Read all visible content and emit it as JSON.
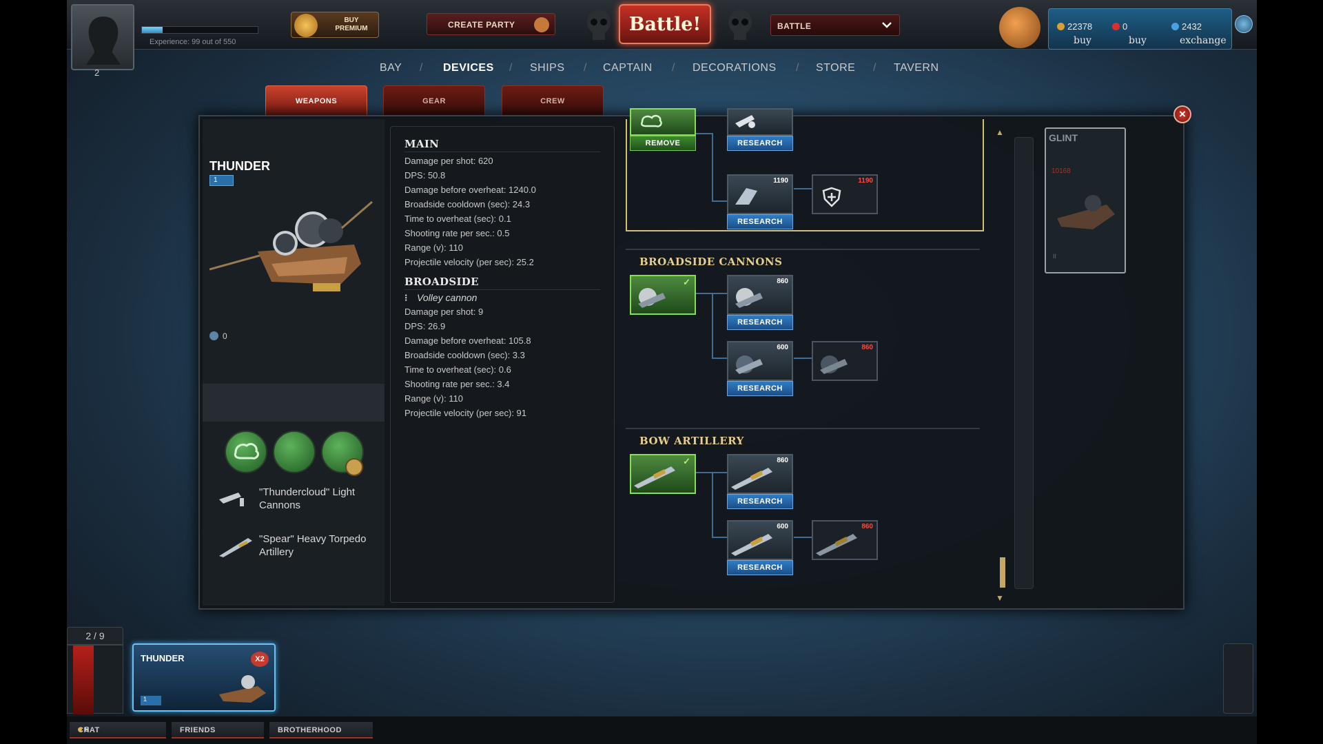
{
  "player": {
    "level": "2",
    "experience_text": "Experience: 99 out of 550",
    "experience_fraction": 0.18
  },
  "topbar": {
    "buy_premium": "BUY PREMIUM",
    "create_party": "CREATE PARTY",
    "battle": "Battle!",
    "battle_mode": "BATTLE"
  },
  "currency": {
    "gold": "22378",
    "gold_action": "buy",
    "red": "0",
    "red_action": "buy",
    "blue": "2432",
    "blue_action": "exchange",
    "gold_color": "#d8a030",
    "red_color": "#d83030",
    "blue_color": "#4aa0e0"
  },
  "nav": {
    "items": [
      "BAY",
      "DEVICES",
      "SHIPS",
      "CAPTAIN",
      "DECORATIONS",
      "STORE",
      "TAVERN"
    ],
    "active": "DEVICES"
  },
  "subtabs": {
    "items": [
      "WEAPONS",
      "GEAR",
      "CREW"
    ],
    "active": "WEAPONS"
  },
  "ship": {
    "name": "THUNDER",
    "level": "1",
    "count": "0",
    "weapons": [
      {
        "label": "\"Thundercloud\" Light Cannons",
        "icon": "light-cannon-icon"
      },
      {
        "label": "\"Spear\" Heavy Torpedo Artillery",
        "icon": "torpedo-icon"
      }
    ]
  },
  "stats": {
    "main_title": "MAIN",
    "main": [
      "Damage per shot:  620",
      "DPS:  50.8",
      "Damage before overheat:  1240.0",
      "Broadside cooldown (sec):  24.3",
      "Time to overheat (sec):  0.1",
      "Shooting rate per sec.:  0.5",
      "Range (v):  110",
      "Projectile velocity (per sec):  25.2"
    ],
    "broadside_title": "BROADSIDE",
    "broadside_weapon": "Volley cannon",
    "broadside": [
      "Damage per shot:  9",
      "DPS:  26.9",
      "Damage before overheat:  105.8",
      "Broadside cooldown (sec):  3.3",
      "Time to overheat (sec):  0.6",
      "Shooting rate per sec.:  3.4",
      "Range (v):  110",
      "Projectile velocity (per sec):  91"
    ]
  },
  "tree": {
    "remove_label": "REMOVE",
    "research_label": "RESEARCH",
    "top_prices": [
      "1190",
      "1190"
    ],
    "broadside_title": "BROADSIDE CANNONS",
    "broadside_prices": [
      "860",
      "600",
      "860"
    ],
    "bow_title": "BOW ARTILLERY",
    "bow_prices": [
      "860",
      "600",
      "860"
    ]
  },
  "next_ship": {
    "name": "GLINT",
    "requirement": "10168",
    "level": "II"
  },
  "hangar": {
    "count": "2 / 9",
    "card_name": "THUNDER",
    "card_badge": "X2",
    "card_level": "1"
  },
  "bottom": {
    "chat": "CHAT",
    "chat_count": "5",
    "friends": "FRIENDS",
    "brotherhood": "BROTHERHOOD"
  }
}
